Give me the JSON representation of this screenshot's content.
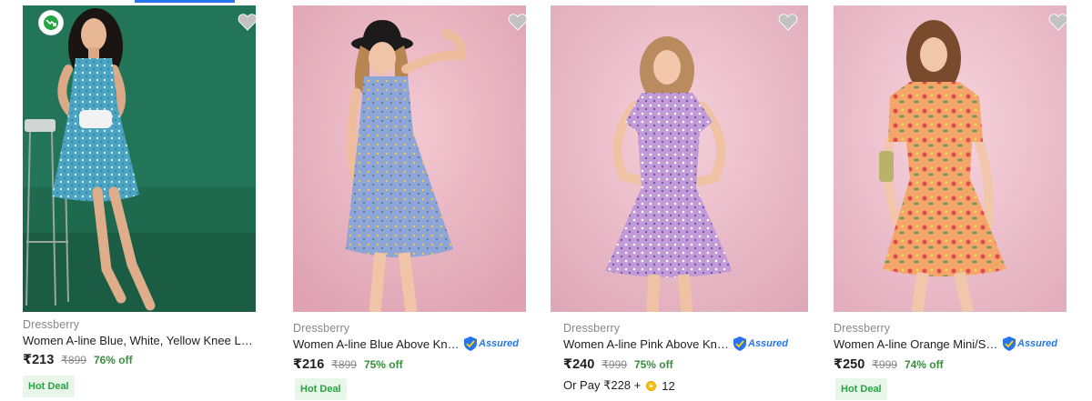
{
  "colors": {
    "accent": "#2874f0",
    "discount_green": "#388e3c",
    "hot_deal_bg": "#e8f5e9",
    "hot_deal_text": "#26a541"
  },
  "products": [
    {
      "brand": "Dressberry",
      "title": "Women A-line Blue, White, Yellow Knee Length Dress",
      "price": "₹213",
      "mrp": "₹899",
      "discount": "76% off",
      "badge": "Hot Deal",
      "image_icon": "dress-photo-teal-blue",
      "trend_icon": "price-drop-trend-icon"
    },
    {
      "brand": "Dressberry",
      "title": "Women A-line Blue Above Knee/Mid Thigh Length Dress",
      "assured": "Assured",
      "price": "₹216",
      "mrp": "₹899",
      "discount": "75% off",
      "badge": "Hot Deal",
      "image_icon": "dress-photo-light-blue"
    },
    {
      "brand": "Dressberry",
      "title": "Women A-line Pink Above Knee/Mid Thigh Length Dress",
      "assured": "Assured",
      "price": "₹240",
      "mrp": "₹999",
      "discount": "75% off",
      "or_pay": "Or Pay ₹228 +",
      "coins": "12",
      "image_icon": "dress-photo-pink-floral"
    },
    {
      "brand": "Dressberry",
      "title": "Women A-line Orange Mini/Short Dress",
      "assured": "Assured",
      "price": "₹250",
      "mrp": "₹999",
      "discount": "74% off",
      "badge": "Hot Deal",
      "image_icon": "dress-photo-orange-floral"
    }
  ]
}
